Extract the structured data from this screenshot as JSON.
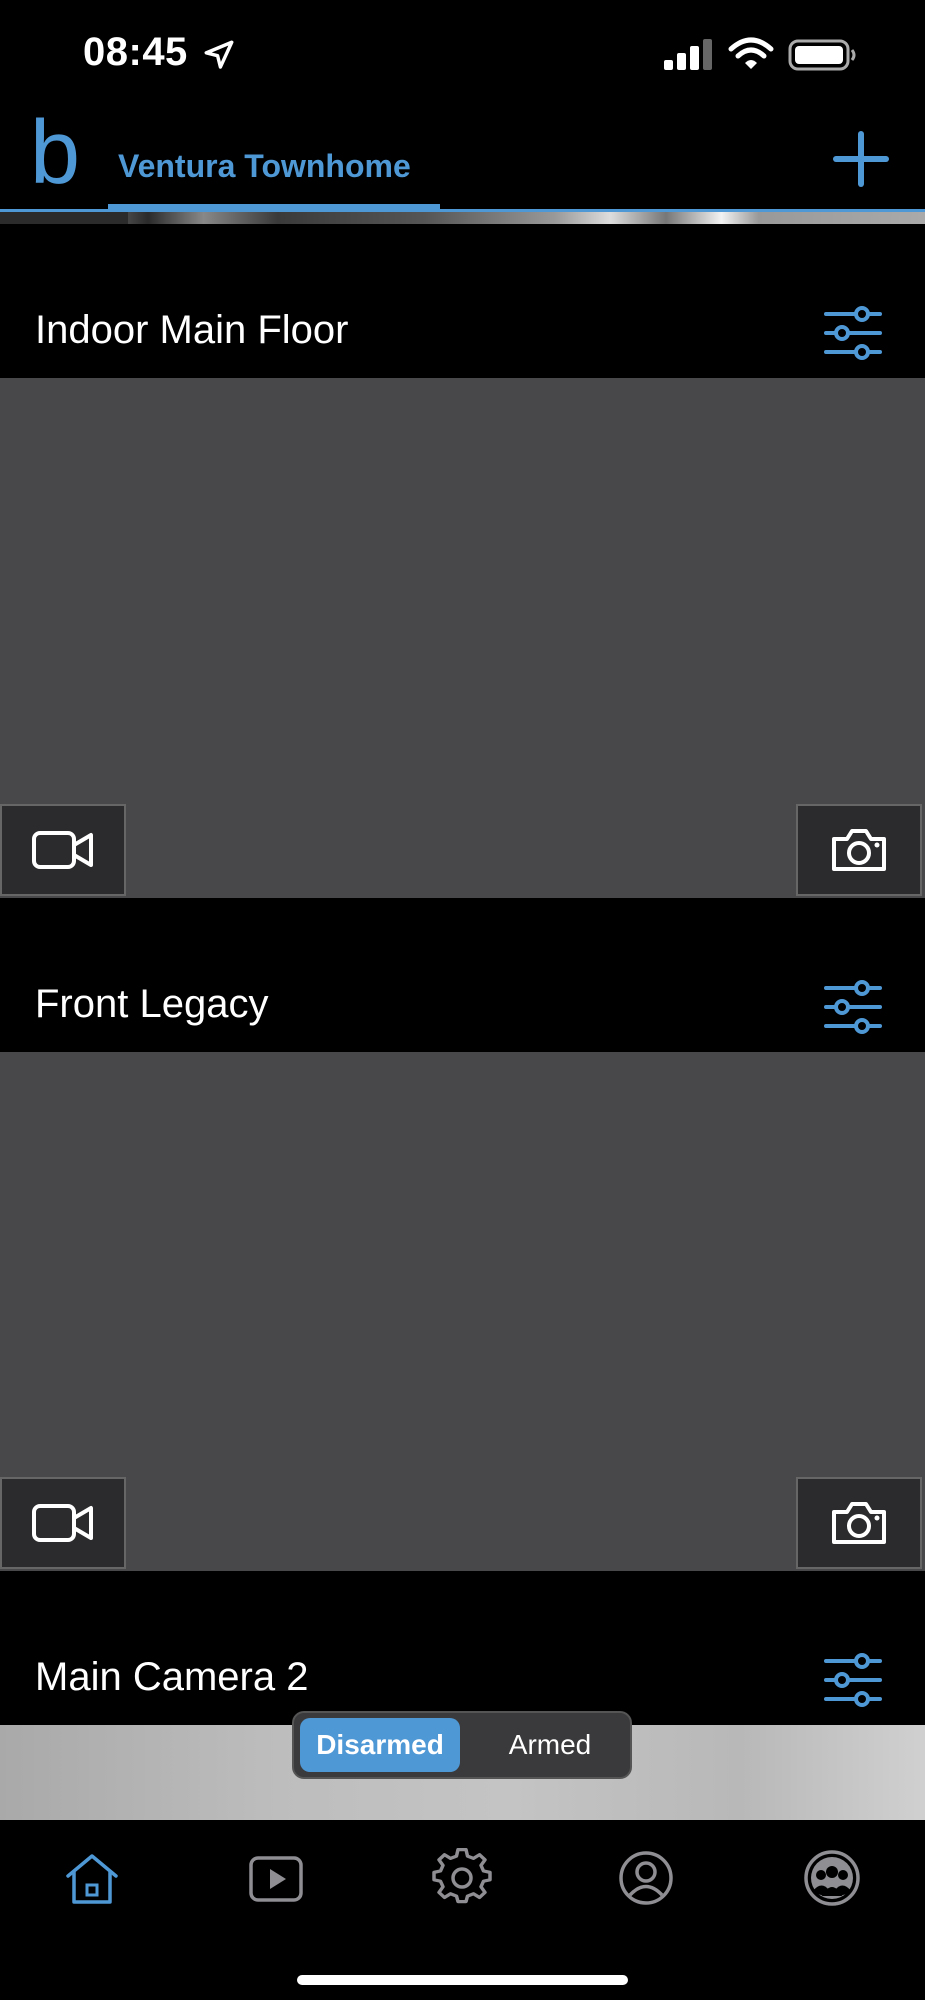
{
  "status_bar": {
    "time": "08:45",
    "icons": [
      "location-arrow-icon",
      "cellular-signal-icon",
      "wifi-icon",
      "battery-icon"
    ]
  },
  "header": {
    "logo_text": "b",
    "location_tab_label": "Ventura Townhome",
    "add_icon": "plus-icon",
    "accent_color": "#4f98d6"
  },
  "cameras": [
    {
      "name": "Indoor Main Floor",
      "settings_icon": "sliders-icon",
      "record_icon": "video-camera-icon",
      "snapshot_icon": "camera-icon"
    },
    {
      "name": "Front Legacy",
      "settings_icon": "sliders-icon",
      "record_icon": "video-camera-icon",
      "snapshot_icon": "camera-icon"
    },
    {
      "name": "Main Camera 2",
      "settings_icon": "sliders-icon"
    }
  ],
  "security_mode": {
    "options": [
      "Disarmed",
      "Armed"
    ],
    "selected": "Disarmed"
  },
  "tab_bar": {
    "tabs": [
      "home-icon",
      "play-icon",
      "gear-icon",
      "account-icon",
      "community-icon"
    ],
    "active": "home-icon"
  }
}
